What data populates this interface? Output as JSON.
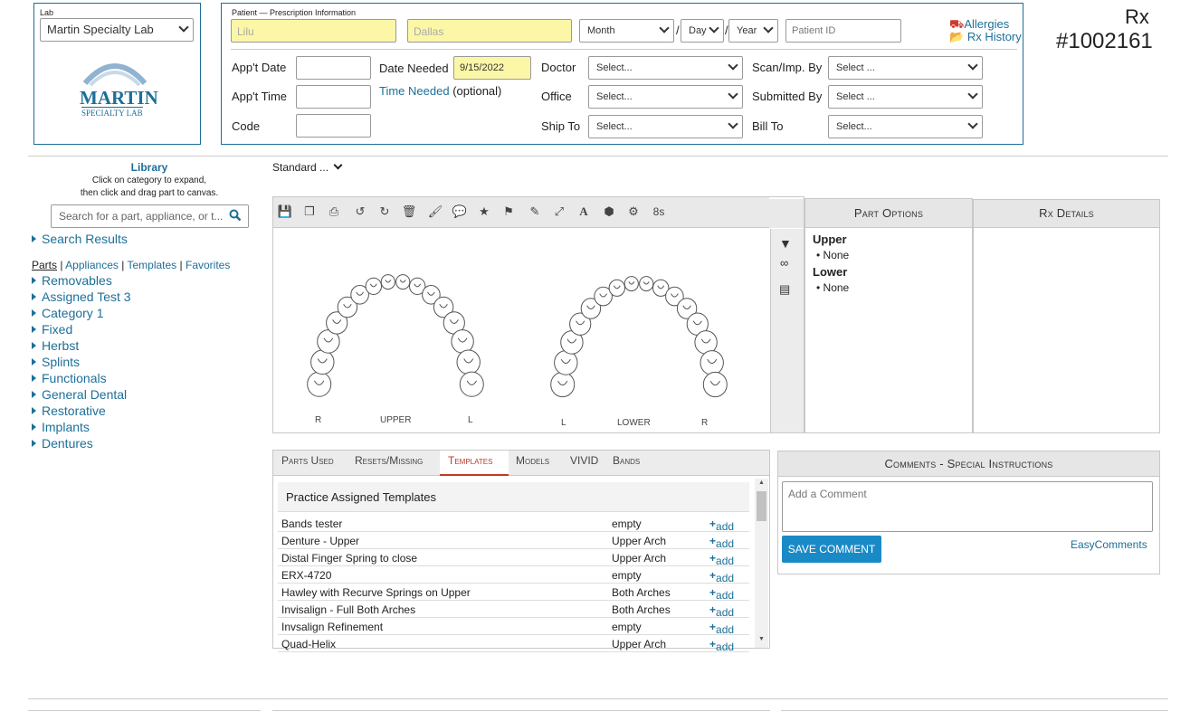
{
  "lab": {
    "caption": "Lab",
    "selected": "Martin Specialty Lab",
    "logo_line1": "MARTIN",
    "logo_line2": "SPECIALTY LAB"
  },
  "patient": {
    "caption": "Patient — Prescription Information",
    "first": "Lilu",
    "last": "Dallas",
    "month": "Month",
    "day": "Day",
    "year": "Year",
    "sep": "/",
    "id_placeholder": "Patient ID"
  },
  "links": {
    "allergies": "Allergies",
    "rx_history": "Rx History"
  },
  "rx": {
    "label": "Rx",
    "number": "#1002161"
  },
  "form": {
    "appt_date": "App't Date",
    "appt_time": "App't Time",
    "code": "Code",
    "date_needed": "Date Needed",
    "date_needed_value": "9/15/2022",
    "time_needed": "Time Needed",
    "optional": "(optional)",
    "doctor": "Doctor",
    "office": "Office",
    "ship_to": "Ship To",
    "scan_by": "Scan/Imp. By",
    "submitted_by": "Submitted By",
    "bill_to": "Bill To",
    "select_a": "Select...",
    "select_b": "Select ..."
  },
  "library": {
    "title": "Library",
    "hint1": "Click on category to expand,",
    "hint2": "then click and drag part to canvas.",
    "search_placeholder": "Search for a part, appliance, or t...",
    "search_results": "Search Results",
    "nav": [
      "Parts",
      "Appliances",
      "Templates",
      "Favorites"
    ],
    "sep": "|",
    "categories": [
      "Removables",
      "Assigned Test 3",
      "Category 1",
      "Fixed",
      "Herbst",
      "Splints",
      "Functionals",
      "General Dental",
      "Restorative",
      "Implants",
      "Dentures"
    ]
  },
  "standard": "Standard ...",
  "toolbar": {
    "counter": "8s"
  },
  "chart": {
    "upper": "UPPER",
    "lower": "LOWER",
    "R": "R",
    "L": "L"
  },
  "part_options": {
    "title": "Part Options",
    "upper": "Upper",
    "lower": "Lower",
    "none": "None"
  },
  "rx_details": {
    "title": "Rx Details"
  },
  "tabs": [
    "Parts Used",
    "Resets/Missing",
    "Templates",
    "Models",
    "VIVID",
    "Bands"
  ],
  "templates": {
    "header": "Practice Assigned Templates",
    "add": "add",
    "rows": [
      {
        "name": "Bands tester",
        "arch": "empty"
      },
      {
        "name": "Denture - Upper",
        "arch": "Upper Arch"
      },
      {
        "name": "Distal Finger Spring to close",
        "arch": "Upper Arch"
      },
      {
        "name": "ERX-4720",
        "arch": "empty"
      },
      {
        "name": "Hawley with Recurve Springs on Upper",
        "arch": "Both Arches"
      },
      {
        "name": "Invisalign - Full Both Arches",
        "arch": "Both Arches"
      },
      {
        "name": "Invsalign Refinement",
        "arch": "empty"
      },
      {
        "name": "Quad-Helix",
        "arch": "Upper Arch"
      }
    ]
  },
  "comments": {
    "title": "Comments - Special Instructions",
    "placeholder": "Add a Comment",
    "save": "SAVE COMMENT",
    "easy": "EasyComments"
  },
  "colors": {
    "link": "#1d6f98",
    "highlight": "#fbf7a6",
    "border_blue": "#1d6f98",
    "save_btn": "#1a8ac6"
  }
}
